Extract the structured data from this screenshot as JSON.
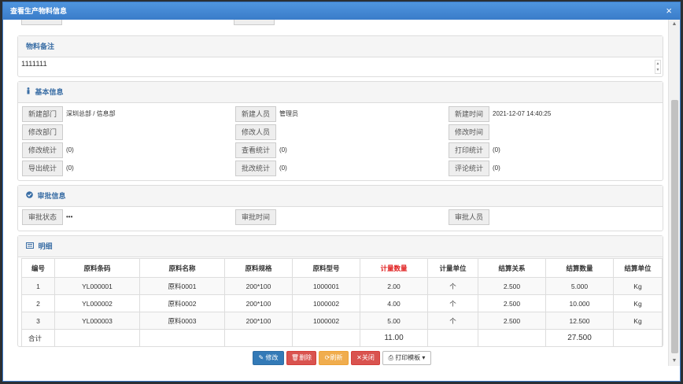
{
  "window": {
    "title": "查看生产物料信息",
    "close_icon": "×"
  },
  "remarks": {
    "title": "物料备注",
    "value": "1111111"
  },
  "basic": {
    "title": "基本信息",
    "fields": [
      {
        "label": "新建部门",
        "value": "深圳总部 / 信息部"
      },
      {
        "label": "新建人员",
        "value": "管理员"
      },
      {
        "label": "新建时间",
        "value": "2021-12-07 14:40:25"
      },
      {
        "label": "修改部门",
        "value": ""
      },
      {
        "label": "修改人员",
        "value": ""
      },
      {
        "label": "修改时间",
        "value": ""
      },
      {
        "label": "修改统计",
        "value": "(0)"
      },
      {
        "label": "查看统计",
        "value": "(0)"
      },
      {
        "label": "打印统计",
        "value": "(0)"
      },
      {
        "label": "导出统计",
        "value": "(0)"
      },
      {
        "label": "批改统计",
        "value": "(0)"
      },
      {
        "label": "评论统计",
        "value": "(0)"
      }
    ]
  },
  "audit": {
    "title": "审批信息",
    "fields": [
      {
        "label": "审批状态",
        "value": "•••"
      },
      {
        "label": "审批时间",
        "value": ""
      },
      {
        "label": "审批人员",
        "value": ""
      }
    ]
  },
  "detail": {
    "title": "明细",
    "columns": [
      "编号",
      "原料条码",
      "原料名称",
      "原料规格",
      "原料型号",
      "计量数量",
      "计量单位",
      "结算关系",
      "结算数量",
      "结算单位"
    ],
    "rows": [
      [
        "1",
        "YL000001",
        "原料0001",
        "200*100",
        "1000001",
        "2.00",
        "个",
        "2.500",
        "5.000",
        "Kg"
      ],
      [
        "2",
        "YL000002",
        "原料0002",
        "200*100",
        "1000002",
        "4.00",
        "个",
        "2.500",
        "10.000",
        "Kg"
      ],
      [
        "3",
        "YL000003",
        "原料0003",
        "200*100",
        "1000002",
        "5.00",
        "个",
        "2.500",
        "12.500",
        "Kg"
      ]
    ],
    "total_label": "合计",
    "total_qty": "11.00",
    "total_settle": "27.500"
  },
  "buttons": {
    "edit": "修改",
    "delete": "删除",
    "refresh": "刷新",
    "close": "关闭",
    "print": "打印模板"
  },
  "colors": {
    "accent": "#337ab7",
    "title_bar": "#3a7cc9",
    "danger": "#d9534f",
    "warning": "#f0ad4e",
    "highlight_header": "#e02020"
  }
}
